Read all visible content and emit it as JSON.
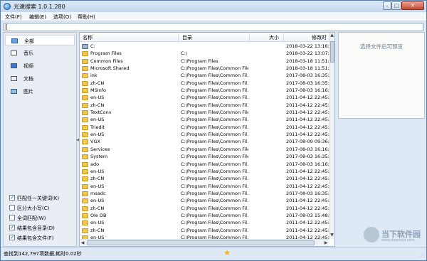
{
  "window": {
    "title": "光速搜索 1.0.1.280"
  },
  "controls": {
    "minimize": "–",
    "maximize": "□",
    "close": "✕"
  },
  "menu": [
    "文件(F)",
    "编辑(E)",
    "选项(O)",
    "帮助(H)"
  ],
  "search": {
    "value": "",
    "placeholder": ""
  },
  "categories": [
    {
      "label": "全部",
      "icon": "all-files-icon",
      "selected": true
    },
    {
      "label": "音乐",
      "icon": "music-icon",
      "selected": false
    },
    {
      "label": "视频",
      "icon": "video-icon",
      "selected": false
    },
    {
      "label": "文档",
      "icon": "document-icon",
      "selected": false
    },
    {
      "label": "图片",
      "icon": "picture-icon",
      "selected": false
    }
  ],
  "options": [
    {
      "label": "匹配任一关键词(K)",
      "checked": true
    },
    {
      "label": "区分大小写(C)",
      "checked": false
    },
    {
      "label": "全词匹配(W)",
      "checked": false
    },
    {
      "label": "结果包含目录(D)",
      "checked": true
    },
    {
      "label": "结果包含文件(F)",
      "checked": true
    }
  ],
  "columns": {
    "name": "名称",
    "dir": "目录",
    "size": "大小",
    "date": "修改时"
  },
  "rows": [
    {
      "name": "C:",
      "dir": "",
      "date": "2018-03-22 13:16:5",
      "icon": "drive-icon"
    },
    {
      "name": "Program Files",
      "dir": "C:\\",
      "date": "2018-03-22 13:07:",
      "icon": "folder-icon"
    },
    {
      "name": "Common Files",
      "dir": "C:\\Program Files",
      "date": "2018-03-18 11:51:",
      "icon": "folder-icon"
    },
    {
      "name": "Microsoft Shared",
      "dir": "C:\\Program Files\\Common Files",
      "date": "2018-03-18 11:51:",
      "icon": "folder-icon"
    },
    {
      "name": "ink",
      "dir": "C:\\Program Files\\Common Fil...",
      "date": "2017-08-03 16:35:",
      "icon": "folder-icon"
    },
    {
      "name": "zh-CN",
      "dir": "C:\\Program Files\\Common Fil...",
      "date": "2017-08-03 16:35:",
      "icon": "folder-icon"
    },
    {
      "name": "MSInfo",
      "dir": "C:\\Program Files\\Common Fil...",
      "date": "2017-08-03 16:16:",
      "icon": "folder-icon"
    },
    {
      "name": "en-US",
      "dir": "C:\\Program Files\\Common Fil...",
      "date": "2011-04-12 22:45:",
      "icon": "folder-icon"
    },
    {
      "name": "zh-CN",
      "dir": "C:\\Program Files\\Common Fil...",
      "date": "2011-04-12 22:45:",
      "icon": "folder-icon"
    },
    {
      "name": "TextConv",
      "dir": "C:\\Program Files\\Common Files",
      "date": "2011-04-12 22:45:",
      "icon": "folder-icon"
    },
    {
      "name": "en-US",
      "dir": "C:\\Program Files\\Common Fil...",
      "date": "2011-04-12 22:45:",
      "icon": "folder-icon"
    },
    {
      "name": "Triedit",
      "dir": "C:\\Program Files\\Common Fil...",
      "date": "2011-04-12 22:45:",
      "icon": "folder-icon"
    },
    {
      "name": "en-US",
      "dir": "C:\\Program Files\\Common Fil...",
      "date": "2011-04-12 22:45:",
      "icon": "folder-icon"
    },
    {
      "name": "VGX",
      "dir": "C:\\Program Files\\Common Fil...",
      "date": "2017-08-09 09:36:",
      "icon": "folder-icon"
    },
    {
      "name": "Services",
      "dir": "C:\\Program Files\\Common Files",
      "date": "2017-08-03 16:16:",
      "icon": "folder-icon"
    },
    {
      "name": "System",
      "dir": "C:\\Program Files\\Common Files",
      "date": "2017-08-03 16:35:",
      "icon": "folder-icon"
    },
    {
      "name": "ado",
      "dir": "C:\\Program Files\\Common Fil...",
      "date": "2017-08-03 16:16:",
      "icon": "folder-icon"
    },
    {
      "name": "en-US",
      "dir": "C:\\Program Files\\Common Fil...",
      "date": "2011-04-12 22:45:",
      "icon": "folder-icon"
    },
    {
      "name": "zh-CN",
      "dir": "C:\\Program Files\\Common Fil...",
      "date": "2011-04-12 22:45:",
      "icon": "folder-icon"
    },
    {
      "name": "en-US",
      "dir": "C:\\Program Files\\Common Fil...",
      "date": "2011-04-12 22:45:",
      "icon": "folder-icon"
    },
    {
      "name": "msadc",
      "dir": "C:\\Program Files\\Common Fil...",
      "date": "2017-08-03 16:35:",
      "icon": "folder-icon"
    },
    {
      "name": "en-US",
      "dir": "C:\\Program Files\\Common Fil...",
      "date": "2011-04-12 22:45:",
      "icon": "folder-icon"
    },
    {
      "name": "zh-CN",
      "dir": "C:\\Program Files\\Common Fil...",
      "date": "2011-04-12 22:45:",
      "icon": "folder-icon"
    },
    {
      "name": "Ole DB",
      "dir": "C:\\Program Files\\Common Fil...",
      "date": "2017-08-03 15:48:",
      "icon": "folder-icon"
    },
    {
      "name": "en-US",
      "dir": "C:\\Program Files\\Common Fil...",
      "date": "2011-04-12 22:45:",
      "icon": "folder-icon"
    },
    {
      "name": "zh-CN",
      "dir": "C:\\Program Files\\Common Fil...",
      "date": "2011-04-12 22:45:",
      "icon": "folder-icon"
    },
    {
      "name": "en-US",
      "dir": "C:\\Program Files\\Common Fil...",
      "date": "2011-04-12 22:45:",
      "icon": "folder-icon"
    }
  ],
  "preview": {
    "text": "选择文件后可预览"
  },
  "status": {
    "text": "查找到142,797项数据,耗时0.02秒"
  },
  "watermark": {
    "text": "当下软件园",
    "url": "www.downxia.com"
  },
  "colors": {
    "selection": "#ffffff",
    "folder": "#f2c94c",
    "accent": "#2a78c8"
  }
}
